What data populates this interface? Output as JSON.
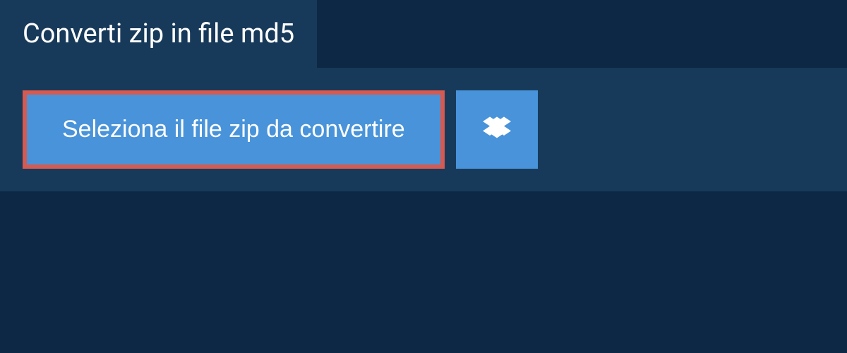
{
  "header": {
    "title": "Converti zip in file md5"
  },
  "actions": {
    "select_file_label": "Seleziona il file zip da convertire",
    "dropbox_icon_name": "dropbox-icon"
  },
  "colors": {
    "background": "#0d2844",
    "panel": "#183a5a",
    "button": "#4893d9",
    "highlight_border": "#d55a52",
    "text": "#ffffff"
  }
}
